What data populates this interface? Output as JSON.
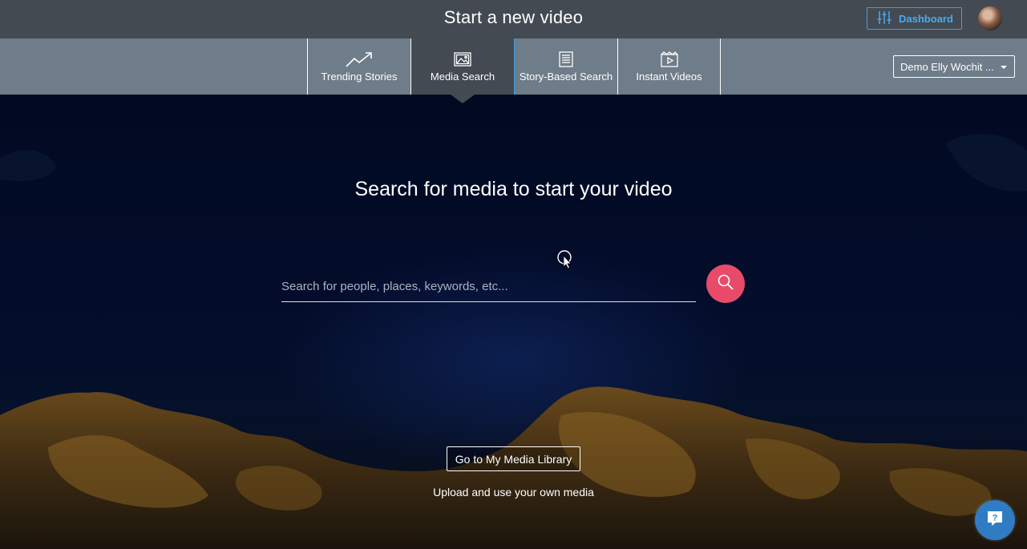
{
  "header": {
    "title": "Start a new video",
    "dashboard_label": "Dashboard"
  },
  "nav": {
    "tabs": [
      {
        "label": "Trending Stories",
        "icon": "trending-icon"
      },
      {
        "label": "Media Search",
        "icon": "image-icon",
        "active": true
      },
      {
        "label": "Story-Based Search",
        "icon": "document-icon"
      },
      {
        "label": "Instant Videos",
        "icon": "video-icon"
      }
    ],
    "account_label": "Demo Elly Wochit ..."
  },
  "main": {
    "heading": "Search for media to start your video",
    "search_placeholder": "Search for people, places, keywords, etc...",
    "library_button": "Go to My Media Library",
    "library_subtext": "Upload and use your own media"
  },
  "colors": {
    "header_bg": "#434a52",
    "nav_bg": "#6f7c89",
    "accent_blue": "#3aa0e6",
    "search_button": "#e84b6a",
    "help_button": "#2f7cc4"
  }
}
